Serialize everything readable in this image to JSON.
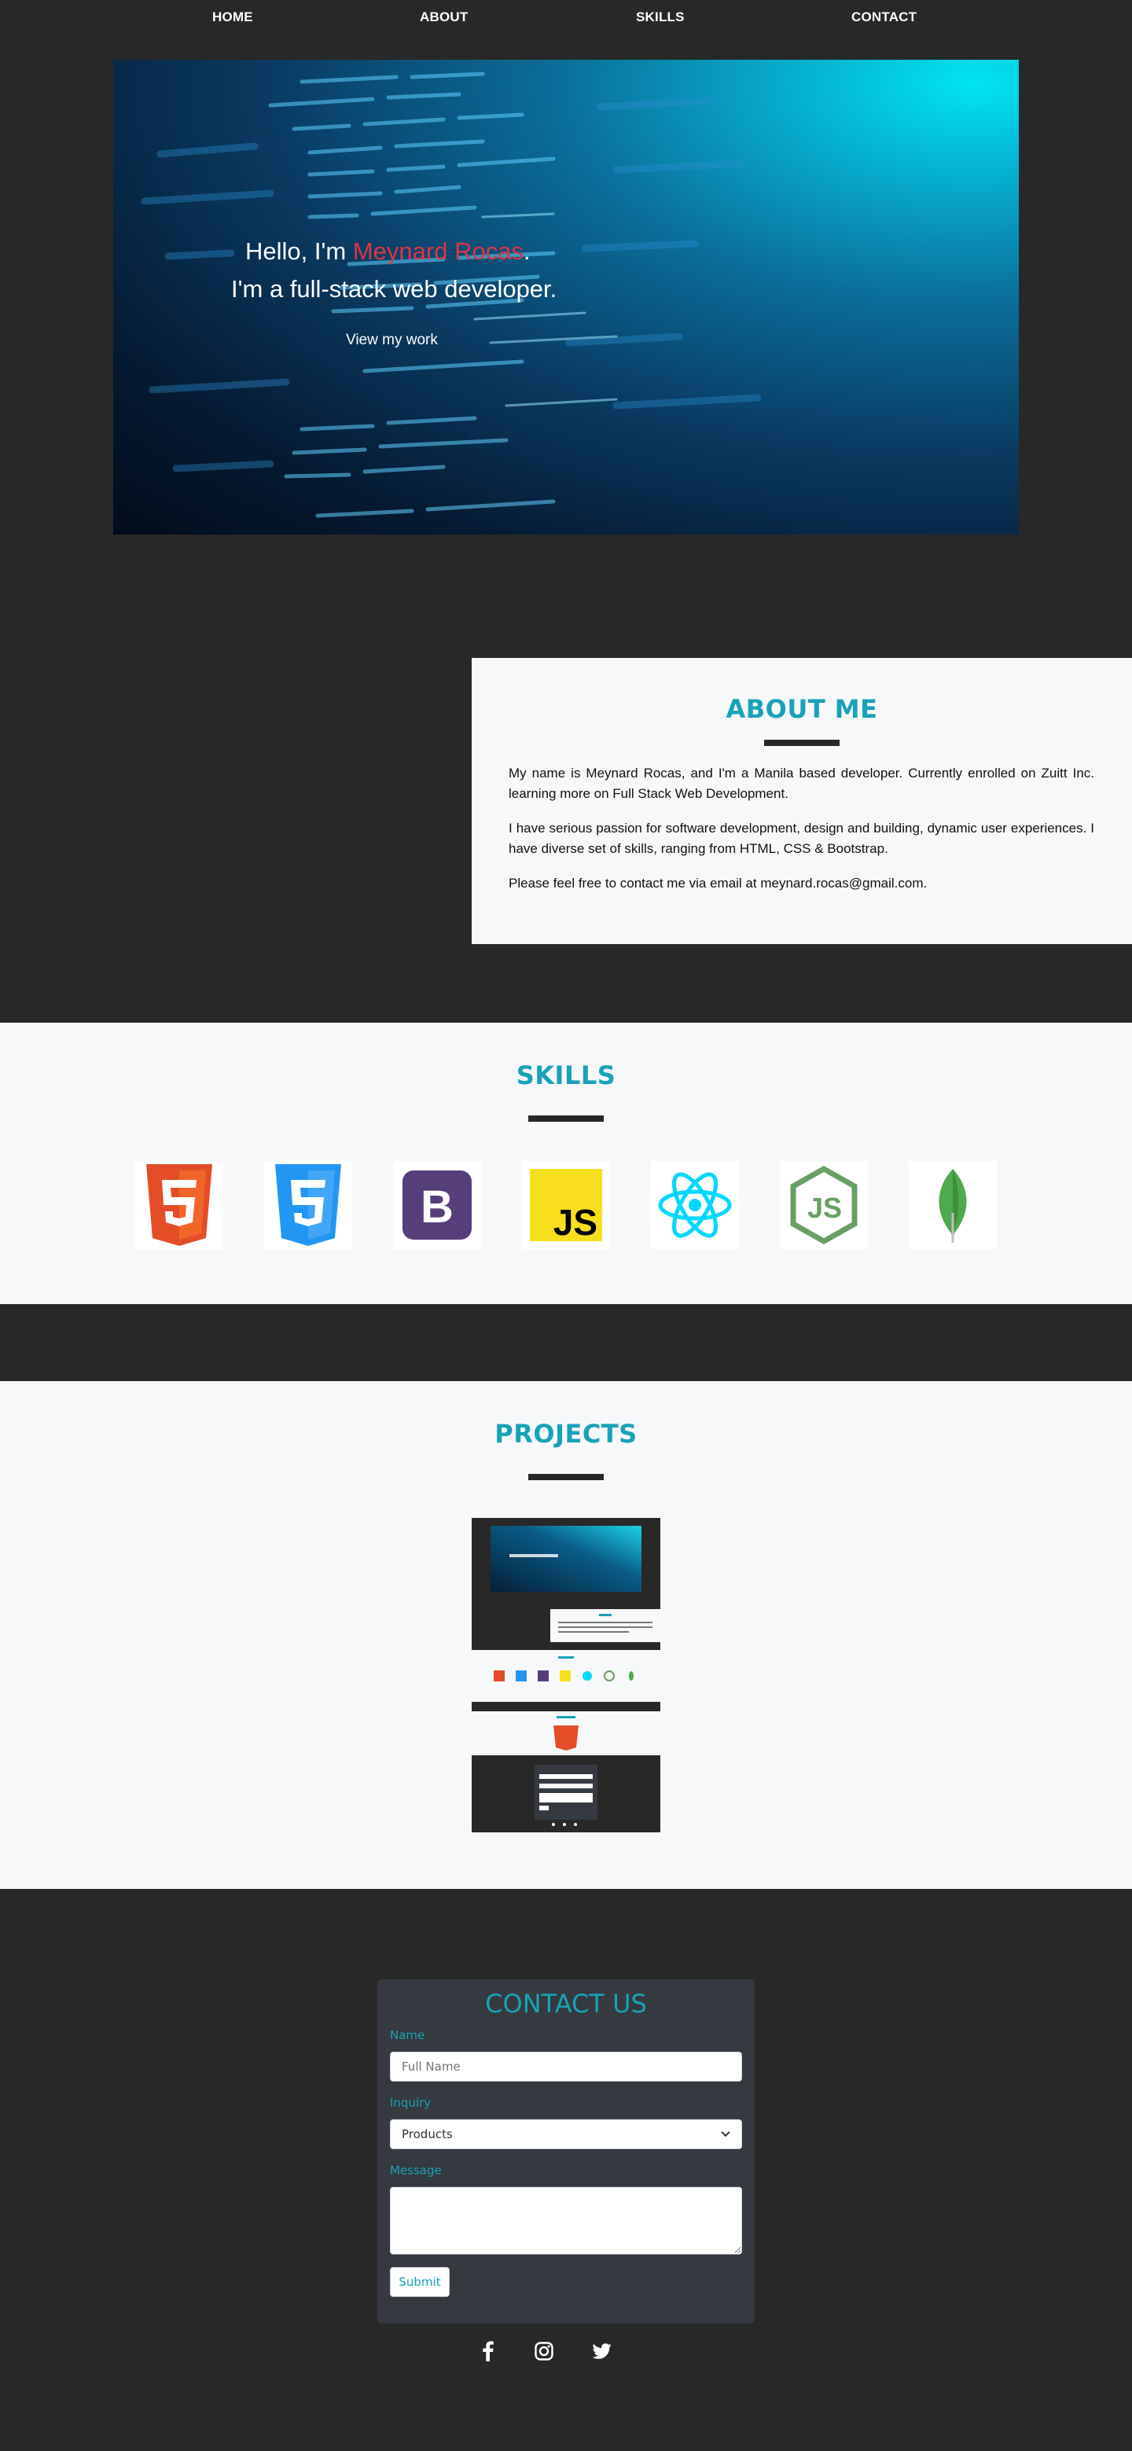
{
  "nav": {
    "home": "HOME",
    "about": "ABOUT",
    "skills": "SKILLS",
    "contact": "CONTACT"
  },
  "hero": {
    "hello_prefix": "Hello, I'm ",
    "name": "Meynard Rocas",
    "hello_suffix": ".",
    "subtitle": "I'm a full-stack web developer.",
    "button": "View my work"
  },
  "about": {
    "title": "ABOUT ME",
    "paragraphs": [
      "My name is Meynard Rocas, and I'm a Manila based developer. Currently enrolled on Zuitt Inc. learning more on Full Stack Web Development.",
      "I have serious passion for software development, design and building, dynamic user experiences. I have diverse set of skills, ranging from HTML, CSS & Bootstrap.",
      "Please feel free to contact me via email at meynard.rocas@gmail.com."
    ]
  },
  "skills": {
    "title": "SKILLS",
    "icons": [
      "html5-icon",
      "css3-icon",
      "bootstrap-icon",
      "javascript-icon",
      "react-icon",
      "nodejs-icon",
      "mongodb-icon"
    ],
    "colors": {
      "html5": "#e44d26",
      "css3": "#2196f3",
      "bootstrap": "#563d7c",
      "javascript": "#f7df1e",
      "react": "#00d8ff",
      "nodejs": "#68a063",
      "mongodb": "#4fa94d"
    }
  },
  "projects": {
    "title": "PROJECTS"
  },
  "contact": {
    "title": "CONTACT US",
    "name_label": "Name",
    "name_placeholder": "Full Name",
    "inquiry_label": "Inquiry",
    "inquiry_value": "Products",
    "message_label": "Message",
    "submit": "Submit"
  },
  "social": [
    "facebook-icon",
    "instagram-icon",
    "twitter-icon"
  ],
  "colors": {
    "background": "#282828",
    "accent": "#17a2b8",
    "name": "#dc3545",
    "panel": "#f6f8fa",
    "form": "#343a40"
  }
}
